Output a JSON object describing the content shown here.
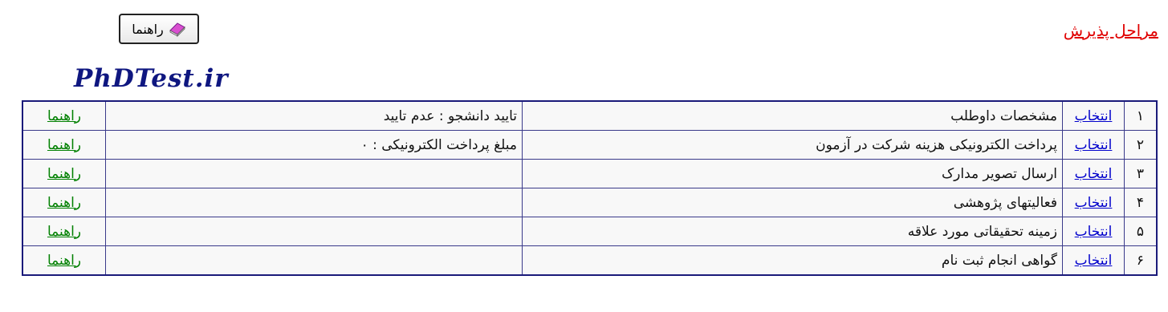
{
  "header": {
    "help_button_label": "راهنما",
    "title_link": "مراحل پذیرش"
  },
  "watermark": "PhDTest.ir",
  "colors": {
    "title": "#e00000",
    "select_link": "#0000cc",
    "help_link": "#008000",
    "watermark": "#0f1780"
  },
  "rows": [
    {
      "num": "۱",
      "select": "انتخاب",
      "name": "مشخصات داوطلب",
      "status": "تایید دانشجو : عدم تایید",
      "help": "راهنما"
    },
    {
      "num": "۲",
      "select": "انتخاب",
      "name": "پرداخت الکترونیکی هزینه شرکت در آزمون",
      "status": "مبلغ پرداخت الکترونیکی : ۰",
      "help": "راهنما"
    },
    {
      "num": "۳",
      "select": "انتخاب",
      "name": "ارسال تصویر مدارک",
      "status": "",
      "help": "راهنما"
    },
    {
      "num": "۴",
      "select": "انتخاب",
      "name": "فعالیتهای پژوهشی",
      "status": "",
      "help": "راهنما"
    },
    {
      "num": "۵",
      "select": "انتخاب",
      "name": "زمینه تحقیقاتی مورد علاقه",
      "status": "",
      "help": "راهنما"
    },
    {
      "num": "۶",
      "select": "انتخاب",
      "name": "گواهی انجام ثبت نام",
      "status": "",
      "help": "راهنما"
    }
  ]
}
